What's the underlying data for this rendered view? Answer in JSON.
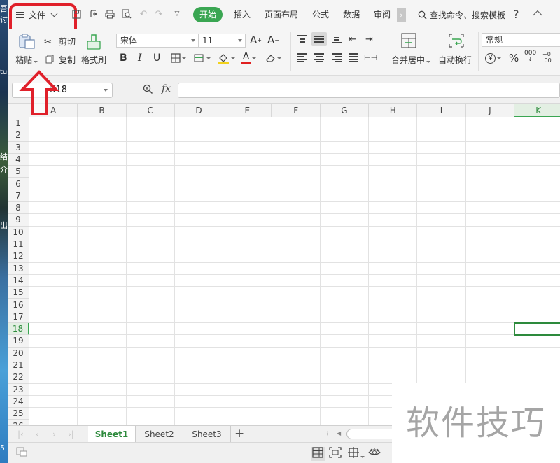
{
  "desktop": {
    "fragments": [
      "吾",
      "讨",
      "tu6",
      "结",
      "介",
      "出",
      "5"
    ]
  },
  "menu": {
    "file_label": "文件"
  },
  "tabs": [
    {
      "label": "开始",
      "active": true
    },
    {
      "label": "插入",
      "active": false
    },
    {
      "label": "页面布局",
      "active": false
    },
    {
      "label": "公式",
      "active": false
    },
    {
      "label": "数据",
      "active": false
    },
    {
      "label": "审阅",
      "active": false
    }
  ],
  "search_cmd": "查找命令、搜索模板",
  "ribbon": {
    "paste": "粘贴",
    "cut": "剪切",
    "copy": "复制",
    "format_painter": "格式刷",
    "font_name": "宋体",
    "font_size": "11",
    "merge_center": "合并居中",
    "wrap_text": "自动换行",
    "number_format": "常规",
    "percent": "%",
    "thousands": "000",
    "inc_decimal": "+0 .00",
    "dec_decimal": ".00 →.0"
  },
  "formula_bar": {
    "cell_ref": "K18",
    "fx": "fx",
    "value": ""
  },
  "columns": [
    "A",
    "B",
    "C",
    "D",
    "E",
    "F",
    "G",
    "H",
    "I",
    "J",
    "K"
  ],
  "rows": [
    "1",
    "2",
    "3",
    "4",
    "5",
    "6",
    "7",
    "8",
    "9",
    "10",
    "11",
    "12",
    "13",
    "14",
    "15",
    "16",
    "17",
    "18",
    "19",
    "20",
    "21",
    "22",
    "23",
    "24",
    "25",
    "26"
  ],
  "selected_cell": {
    "column": "K",
    "row": "18"
  },
  "sheets": [
    {
      "label": "Sheet1",
      "active": true
    },
    {
      "label": "Sheet2",
      "active": false
    },
    {
      "label": "Sheet3",
      "active": false
    }
  ],
  "watermark": "软件技巧",
  "colors": {
    "accent": "#3aa652",
    "annotation": "#e0202a"
  }
}
